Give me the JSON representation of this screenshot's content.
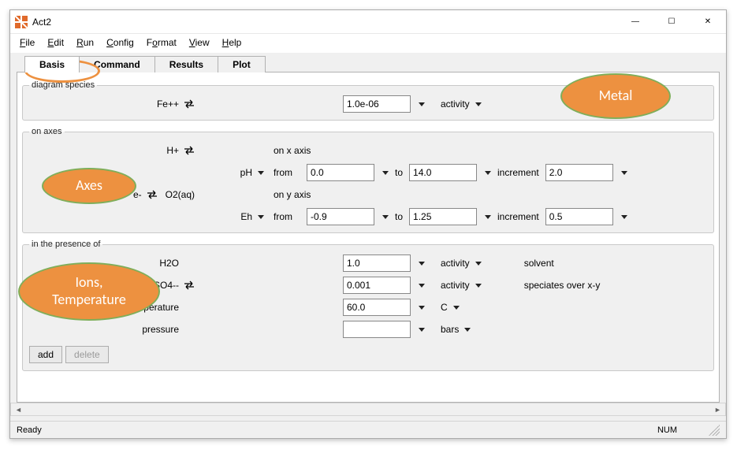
{
  "window": {
    "title": "Act2",
    "controls": {
      "min": "—",
      "max": "☐",
      "close": "✕"
    }
  },
  "menu": {
    "file": "File",
    "edit": "Edit",
    "run": "Run",
    "config": "Config",
    "format": "Format",
    "view": "View",
    "help": "Help"
  },
  "tabs": {
    "basis": "Basis",
    "command": "Command",
    "results": "Results",
    "plot": "Plot"
  },
  "groups": {
    "diagram": "diagram species",
    "axes": "on axes",
    "presence": "in the presence of"
  },
  "diagram": {
    "species": "Fe++",
    "value": "1.0e-06",
    "unit": "activity"
  },
  "axes": {
    "x": {
      "species": "H+",
      "variable": "pH",
      "axis_label": "on x axis",
      "from_label": "from",
      "from": "0.0",
      "to_label": "to",
      "to": "14.0",
      "inc_label": "increment",
      "inc": "2.0"
    },
    "y": {
      "species": "e-",
      "swap_to": "O2(aq)",
      "variable": "Eh",
      "axis_label": "on y axis",
      "from_label": "from",
      "from": "-0.9",
      "to_label": "to",
      "to": "1.25",
      "inc_label": "increment",
      "inc": "0.5"
    }
  },
  "presence": {
    "items": [
      {
        "name": "H2O",
        "swap": false,
        "value": "1.0",
        "unit": "activity",
        "note": "solvent"
      },
      {
        "name": "SO4--",
        "swap": true,
        "value": "0.001",
        "unit": "activity",
        "note": "speciates over x-y"
      },
      {
        "name": "temperature",
        "swap": false,
        "value": "60.0",
        "unit": "C",
        "note": ""
      },
      {
        "name": "pressure",
        "swap": false,
        "value": "",
        "unit": "bars",
        "note": ""
      }
    ],
    "add": "add",
    "delete": "delete"
  },
  "status": {
    "left": "Ready",
    "num": "NUM"
  },
  "callouts": {
    "metal": "Metal",
    "axes": "Axes",
    "ions": "Ions,\nTemperature"
  }
}
